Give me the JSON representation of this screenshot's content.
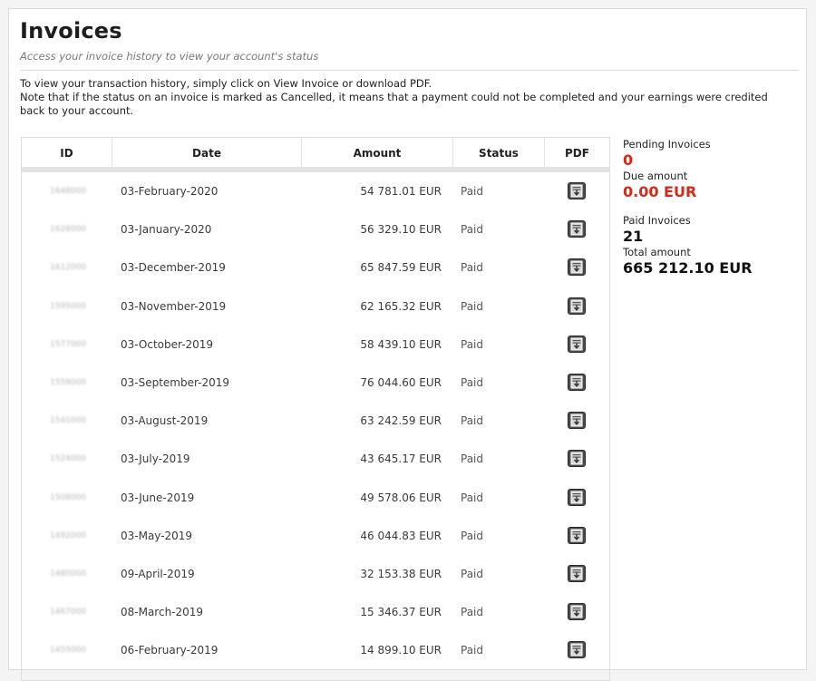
{
  "page": {
    "title": "Invoices",
    "subtitle": "Access your invoice history to view your account's status",
    "intro_line1": "To view your transaction history, simply click on View Invoice or download PDF.",
    "intro_line2": "Note that if the status on an invoice is marked as Cancelled, it means that a payment could not be completed and your earnings were credited back to your account."
  },
  "table": {
    "columns": [
      "ID",
      "Date",
      "Amount",
      "Status",
      "PDF"
    ],
    "rows": [
      {
        "id": "1648000",
        "date": "03-February-2020",
        "amount": "54 781.01 EUR",
        "status": "Paid"
      },
      {
        "id": "1628000",
        "date": "03-January-2020",
        "amount": "56 329.10 EUR",
        "status": "Paid"
      },
      {
        "id": "1612000",
        "date": "03-December-2019",
        "amount": "65 847.59 EUR",
        "status": "Paid"
      },
      {
        "id": "1595000",
        "date": "03-November-2019",
        "amount": "62 165.32 EUR",
        "status": "Paid"
      },
      {
        "id": "1577000",
        "date": "03-October-2019",
        "amount": "58 439.10 EUR",
        "status": "Paid"
      },
      {
        "id": "1559000",
        "date": "03-September-2019",
        "amount": "76 044.60 EUR",
        "status": "Paid"
      },
      {
        "id": "1541000",
        "date": "03-August-2019",
        "amount": "63 242.59 EUR",
        "status": "Paid"
      },
      {
        "id": "1524000",
        "date": "03-July-2019",
        "amount": "43 645.17 EUR",
        "status": "Paid"
      },
      {
        "id": "1508000",
        "date": "03-June-2019",
        "amount": "49 578.06 EUR",
        "status": "Paid"
      },
      {
        "id": "1492000",
        "date": "03-May-2019",
        "amount": "46 044.83 EUR",
        "status": "Paid"
      },
      {
        "id": "1480000",
        "date": "09-April-2019",
        "amount": "32 153.38 EUR",
        "status": "Paid"
      },
      {
        "id": "1467000",
        "date": "08-March-2019",
        "amount": "15 346.37 EUR",
        "status": "Paid"
      },
      {
        "id": "1455000",
        "date": "06-February-2019",
        "amount": "14 899.10 EUR",
        "status": "Paid"
      }
    ],
    "pdf_icon": "download-pdf-icon"
  },
  "summary": {
    "pending_label": "Pending Invoices",
    "pending_value": "0",
    "due_label": "Due amount",
    "due_value": "0.00 EUR",
    "paid_label": "Paid Invoices",
    "paid_value": "21",
    "total_label": "Total amount",
    "total_value": "665 212.10 EUR"
  },
  "colors": {
    "accent_red": "#d02a18",
    "text_dark": "#1e1e1e",
    "header_bar": "#e3e3e3",
    "pdf_button": "#4b4b4b"
  }
}
